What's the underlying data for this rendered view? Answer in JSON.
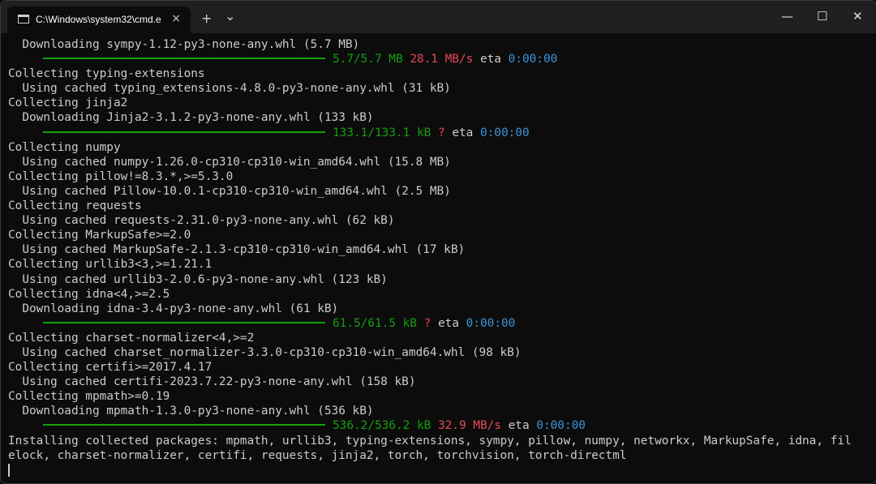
{
  "window": {
    "tab_title": "C:\\Windows\\system32\\cmd.e",
    "tab_close": "×",
    "new_tab": "+",
    "dropdown": "⌄",
    "minimize": "—",
    "maximize": "☐",
    "close": "✕"
  },
  "colors": {
    "green": "#13a10e",
    "red": "#e74856",
    "blue": "#3a96dd",
    "text": "#cccccc",
    "background": "#0c0c0c"
  },
  "terminal": {
    "lines": [
      "  Downloading sympy-1.12-py3-none-any.whl (5.7 MB)",
      "",
      "Collecting typing-extensions",
      "  Using cached typing_extensions-4.8.0-py3-none-any.whl (31 kB)",
      "Collecting jinja2",
      "  Downloading Jinja2-3.1.2-py3-none-any.whl (133 kB)",
      "",
      "Collecting numpy",
      "  Using cached numpy-1.26.0-cp310-cp310-win_amd64.whl (15.8 MB)",
      "Collecting pillow!=8.3.*,>=5.3.0",
      "  Using cached Pillow-10.0.1-cp310-cp310-win_amd64.whl (2.5 MB)",
      "Collecting requests",
      "  Using cached requests-2.31.0-py3-none-any.whl (62 kB)",
      "Collecting MarkupSafe>=2.0",
      "  Using cached MarkupSafe-2.1.3-cp310-cp310-win_amd64.whl (17 kB)",
      "Collecting urllib3<3,>=1.21.1",
      "  Using cached urllib3-2.0.6-py3-none-any.whl (123 kB)",
      "Collecting idna<4,>=2.5",
      "  Downloading idna-3.4-py3-none-any.whl (61 kB)",
      "",
      "Collecting charset-normalizer<4,>=2",
      "  Using cached charset_normalizer-3.3.0-cp310-cp310-win_amd64.whl (98 kB)",
      "Collecting certifi>=2017.4.17",
      "  Using cached certifi-2023.7.22-py3-none-any.whl (158 kB)",
      "Collecting mpmath>=0.19",
      "  Downloading mpmath-1.3.0-py3-none-any.whl (536 kB)",
      "",
      "Installing collected packages: mpmath, urllib3, typing-extensions, sympy, pillow, numpy, networkx, MarkupSafe, idna, fil",
      "elock, charset-normalizer, certifi, requests, jinja2, torch, torchvision, torch-directml"
    ],
    "progress": [
      {
        "progress": 1.0,
        "size": "5.7/5.7 MB",
        "speed": "28.1 MB/s",
        "eta_label": "eta",
        "eta": "0:00:00"
      },
      {
        "progress": 1.0,
        "size": "133.1/133.1 kB",
        "speed": "?",
        "eta_label": "eta",
        "eta": "0:00:00"
      },
      {
        "progress": 1.0,
        "size": "61.5/61.5 kB",
        "speed": "?",
        "eta_label": "eta",
        "eta": "0:00:00"
      },
      {
        "progress": 1.0,
        "size": "536.2/536.2 kB",
        "speed": "32.9 MB/s",
        "eta_label": "eta",
        "eta": "0:00:00"
      }
    ]
  }
}
